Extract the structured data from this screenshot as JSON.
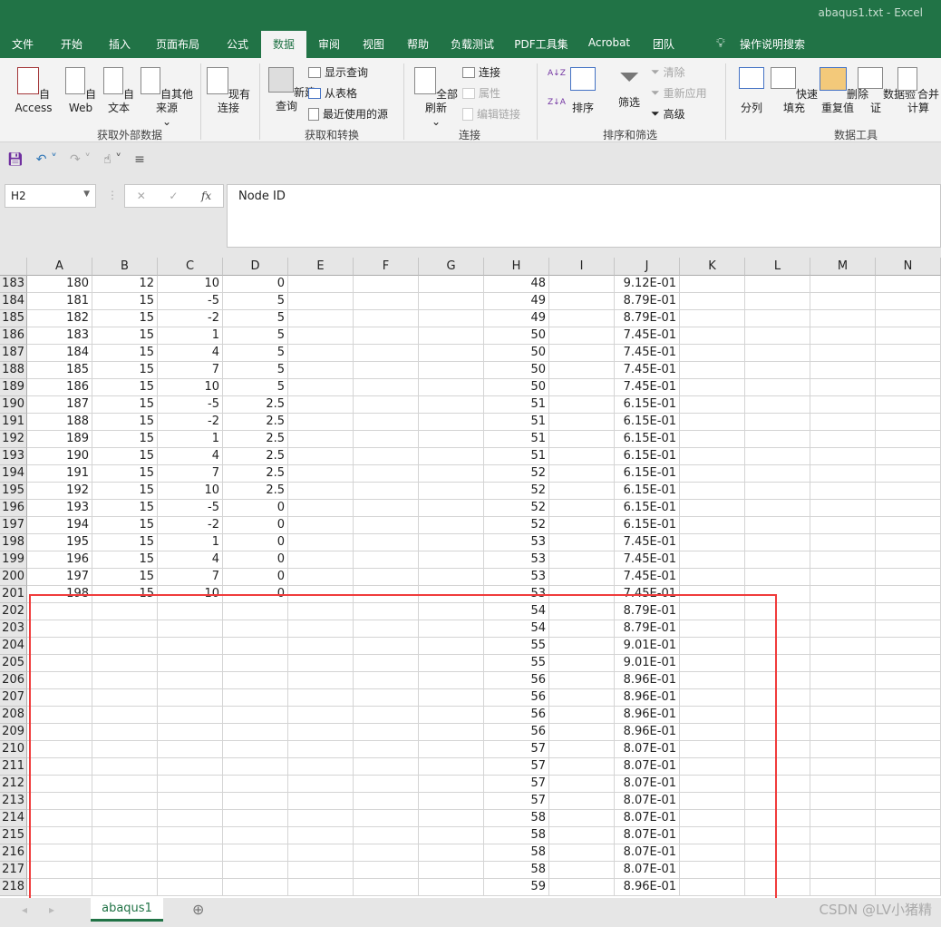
{
  "window": {
    "title": "abaqus1.txt  -  Excel"
  },
  "tabs": [
    "文件",
    "开始",
    "插入",
    "页面布局",
    "公式",
    "数据",
    "审阅",
    "视图",
    "帮助",
    "负载测试",
    "PDF工具集",
    "Acrobat",
    "团队"
  ],
  "active_tab": "数据",
  "tell_me": "操作说明搜索",
  "ribbon": {
    "get_external": {
      "label": "获取外部数据",
      "access": "自 Access",
      "web": "自\nWeb",
      "text": "自文本",
      "other": "自其他来源",
      "existing": "现有连接"
    },
    "get_transform": {
      "label": "获取和转换",
      "new_query": "新建\n查询",
      "show_queries": "显示查询",
      "from_table": "从表格",
      "recent": "最近使用的源"
    },
    "connections": {
      "label": "连接",
      "refresh_all": "全部刷新",
      "connections": "连接",
      "properties": "属性",
      "edit_links": "编辑链接"
    },
    "sort_filter": {
      "label": "排序和筛选",
      "sort": "排序",
      "filter": "筛选",
      "clear": "清除",
      "reapply": "重新应用",
      "advanced": "高级"
    },
    "data_tools": {
      "label": "数据工具",
      "text_to_columns": "分列",
      "flash_fill": "快速填充",
      "remove_dup": "删除\n重复值",
      "validation": "数据验\n证",
      "consolidate": "合并计算"
    }
  },
  "formula_bar": {
    "name_box": "H2",
    "content": "Node ID",
    "fx": "fx"
  },
  "columns": [
    "A",
    "B",
    "C",
    "D",
    "E",
    "F",
    "G",
    "H",
    "I",
    "J",
    "K",
    "L",
    "M",
    "N"
  ],
  "rows": [
    [
      183,
      180,
      12,
      10,
      0,
      48,
      "9.12E-01"
    ],
    [
      184,
      181,
      15,
      -5,
      5,
      49,
      "8.79E-01"
    ],
    [
      185,
      182,
      15,
      -2,
      5,
      49,
      "8.79E-01"
    ],
    [
      186,
      183,
      15,
      1,
      5,
      50,
      "7.45E-01"
    ],
    [
      187,
      184,
      15,
      4,
      5,
      50,
      "7.45E-01"
    ],
    [
      188,
      185,
      15,
      7,
      5,
      50,
      "7.45E-01"
    ],
    [
      189,
      186,
      15,
      10,
      5,
      50,
      "7.45E-01"
    ],
    [
      190,
      187,
      15,
      -5,
      2.5,
      51,
      "6.15E-01"
    ],
    [
      191,
      188,
      15,
      -2,
      2.5,
      51,
      "6.15E-01"
    ],
    [
      192,
      189,
      15,
      1,
      2.5,
      51,
      "6.15E-01"
    ],
    [
      193,
      190,
      15,
      4,
      2.5,
      51,
      "6.15E-01"
    ],
    [
      194,
      191,
      15,
      7,
      2.5,
      52,
      "6.15E-01"
    ],
    [
      195,
      192,
      15,
      10,
      2.5,
      52,
      "6.15E-01"
    ],
    [
      196,
      193,
      15,
      -5,
      0,
      52,
      "6.15E-01"
    ],
    [
      197,
      194,
      15,
      -2,
      0,
      52,
      "6.15E-01"
    ],
    [
      198,
      195,
      15,
      1,
      0,
      53,
      "7.45E-01"
    ],
    [
      199,
      196,
      15,
      4,
      0,
      53,
      "7.45E-01"
    ],
    [
      200,
      197,
      15,
      7,
      0,
      53,
      "7.45E-01"
    ],
    [
      201,
      198,
      15,
      10,
      0,
      53,
      "7.45E-01"
    ],
    [
      202,
      null,
      null,
      null,
      null,
      54,
      "8.79E-01"
    ],
    [
      203,
      null,
      null,
      null,
      null,
      54,
      "8.79E-01"
    ],
    [
      204,
      null,
      null,
      null,
      null,
      55,
      "9.01E-01"
    ],
    [
      205,
      null,
      null,
      null,
      null,
      55,
      "9.01E-01"
    ],
    [
      206,
      null,
      null,
      null,
      null,
      56,
      "8.96E-01"
    ],
    [
      207,
      null,
      null,
      null,
      null,
      56,
      "8.96E-01"
    ],
    [
      208,
      null,
      null,
      null,
      null,
      56,
      "8.96E-01"
    ],
    [
      209,
      null,
      null,
      null,
      null,
      56,
      "8.96E-01"
    ],
    [
      210,
      null,
      null,
      null,
      null,
      57,
      "8.07E-01"
    ],
    [
      211,
      null,
      null,
      null,
      null,
      57,
      "8.07E-01"
    ],
    [
      212,
      null,
      null,
      null,
      null,
      57,
      "8.07E-01"
    ],
    [
      213,
      null,
      null,
      null,
      null,
      57,
      "8.07E-01"
    ],
    [
      214,
      null,
      null,
      null,
      null,
      58,
      "8.07E-01"
    ],
    [
      215,
      null,
      null,
      null,
      null,
      58,
      "8.07E-01"
    ],
    [
      216,
      null,
      null,
      null,
      null,
      58,
      "8.07E-01"
    ],
    [
      217,
      null,
      null,
      null,
      null,
      58,
      "8.07E-01"
    ],
    [
      218,
      null,
      null,
      null,
      null,
      59,
      "8.96E-01"
    ]
  ],
  "sheet_tab": "abaqus1",
  "watermark": "CSDN @LV小猪精",
  "colors": {
    "brand": "#217346",
    "highlight_box": "#f03c3c"
  }
}
